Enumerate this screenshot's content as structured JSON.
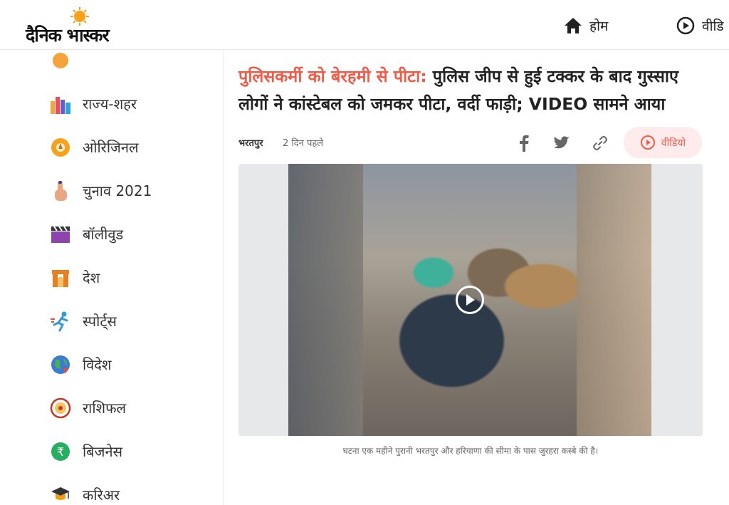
{
  "header": {
    "logo_text": "दैनिक भास्कर",
    "nav": [
      {
        "label": "होम",
        "icon": "home-icon"
      },
      {
        "label": "वीडि",
        "icon": "play-circle-icon"
      }
    ]
  },
  "sidebar": {
    "items": [
      {
        "label": "राज्य-शहर",
        "icon": "city-buildings-icon"
      },
      {
        "label": "ओरिजिनल",
        "icon": "original-badge-icon"
      },
      {
        "label": "चुनाव 2021",
        "icon": "voting-finger-icon"
      },
      {
        "label": "बॉलीवुड",
        "icon": "clapperboard-icon"
      },
      {
        "label": "देश",
        "icon": "india-gate-icon"
      },
      {
        "label": "स्पोर्ट्स",
        "icon": "runner-icon"
      },
      {
        "label": "विदेश",
        "icon": "globe-icon"
      },
      {
        "label": "राशिफल",
        "icon": "zodiac-wheel-icon"
      },
      {
        "label": "बिजनेस",
        "icon": "rupee-coin-icon"
      },
      {
        "label": "करिअर",
        "icon": "graduation-cap-icon"
      }
    ]
  },
  "article": {
    "headline_kicker": "पुलिसकर्मी को बेरहमी से पीटा:",
    "headline_rest": " पुलिस जीप से हुई टक्कर के बाद गुस्साए लोगों ने कांस्टेबल को जमकर पीटा, वर्दी फाड़ी; VIDEO सामने आया",
    "city": "भरतपुर",
    "time": "2 दिन पहले",
    "video_button_label": "वीडियो",
    "caption": "घटना एक महीने पुरानी भरतपुर और हरियाणा की सीमा के पास जुरहरा कस्बे की है।"
  },
  "colors": {
    "accent": "#f05a46",
    "pill_bg": "#fdeceb"
  }
}
